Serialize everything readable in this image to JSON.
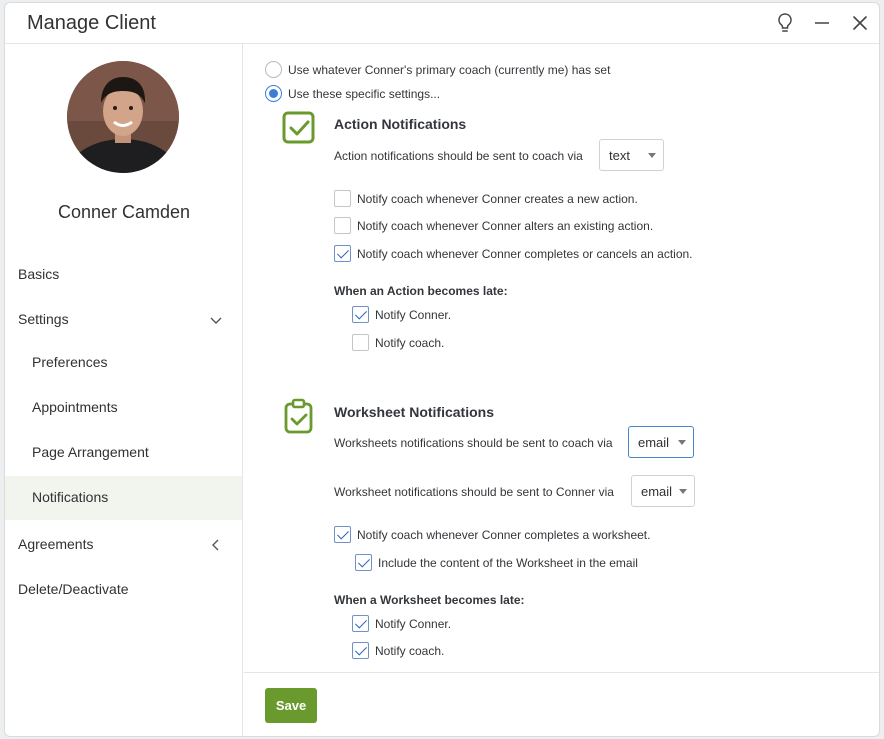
{
  "window": {
    "title": "Manage Client",
    "controls": [
      "lightbulb-icon",
      "minimize-icon",
      "close-icon"
    ]
  },
  "sidebar": {
    "client_name": "Conner Camden",
    "items": [
      {
        "label": "Basics",
        "level": "top"
      },
      {
        "label": "Settings",
        "level": "top",
        "chevron": "down"
      },
      {
        "label": "Preferences",
        "level": "sub"
      },
      {
        "label": "Appointments",
        "level": "sub"
      },
      {
        "label": "Page Arrangement",
        "level": "sub"
      },
      {
        "label": "Notifications",
        "level": "sub",
        "active": true
      },
      {
        "label": "Agreements",
        "level": "top",
        "chevron": "left"
      },
      {
        "label": "Delete/Deactivate",
        "level": "top"
      }
    ]
  },
  "settings_source": {
    "options": [
      {
        "label": "Use whatever Conner's primary coach (currently me) has set",
        "selected": false
      },
      {
        "label": "Use these specific settings...",
        "selected": true
      }
    ]
  },
  "action": {
    "title": "Action Notifications",
    "via_label": "Action notifications should be sent to coach via",
    "via_value": "text",
    "checks": [
      {
        "label": "Notify coach whenever Conner creates a new action.",
        "checked": false
      },
      {
        "label": "Notify coach whenever Conner alters an existing action.",
        "checked": false
      },
      {
        "label": "Notify coach whenever Conner completes or cancels an action.",
        "checked": true
      }
    ],
    "late_title": "When an Action becomes late:",
    "late_checks": [
      {
        "label": "Notify Conner.",
        "checked": true
      },
      {
        "label": "Notify coach.",
        "checked": false
      }
    ]
  },
  "worksheet": {
    "title": "Worksheet Notifications",
    "coach_via_label": "Worksheets notifications should be sent to coach via",
    "coach_via_value": "email",
    "conner_via_label": "Worksheet notifications should be sent to Conner via",
    "conner_via_value": "email",
    "checks": [
      {
        "label": "Notify coach whenever Conner completes a worksheet.",
        "checked": true
      },
      {
        "label": "Include the content of the Worksheet in the email",
        "checked": true
      }
    ],
    "late_title": "When a Worksheet becomes late:",
    "late_checks": [
      {
        "label": "Notify Conner.",
        "checked": true
      },
      {
        "label": "Notify coach.",
        "checked": true
      }
    ]
  },
  "footer": {
    "save_label": "Save"
  },
  "colors": {
    "accent_green": "#6a9a2e",
    "radio_blue": "#3d7fd6",
    "active_nav_bg": "#f1f5ed"
  }
}
